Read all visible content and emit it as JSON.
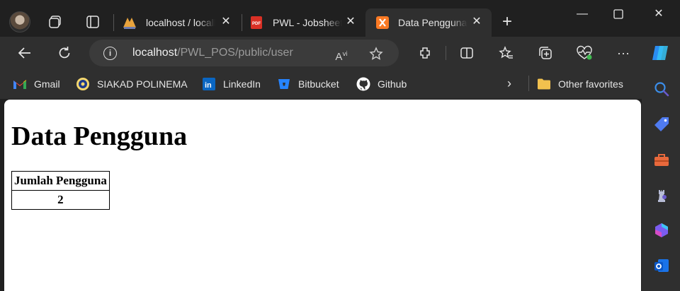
{
  "tabs": [
    {
      "title": "localhost / localhost",
      "icon": "phpmyadmin-icon"
    },
    {
      "title": "PWL - Jobsheet",
      "icon": "pdf-icon"
    },
    {
      "title": "Data Pengguna",
      "icon": "xampp-icon",
      "active": true
    }
  ],
  "address": {
    "host": "localhost",
    "path": "/PWL_POS/public/user"
  },
  "favorites": [
    {
      "label": "Gmail",
      "icon": "gmail-icon"
    },
    {
      "label": "SIAKAD POLINEMA",
      "icon": "polinema-icon"
    },
    {
      "label": "LinkedIn",
      "icon": "linkedin-icon"
    },
    {
      "label": "Bitbucket",
      "icon": "bitbucket-icon"
    },
    {
      "label": "Github",
      "icon": "github-icon"
    }
  ],
  "other_favorites": "Other favorites",
  "page": {
    "heading": "Data Pengguna",
    "table": {
      "header": "Jumlah Pengguna",
      "value": "2"
    }
  }
}
